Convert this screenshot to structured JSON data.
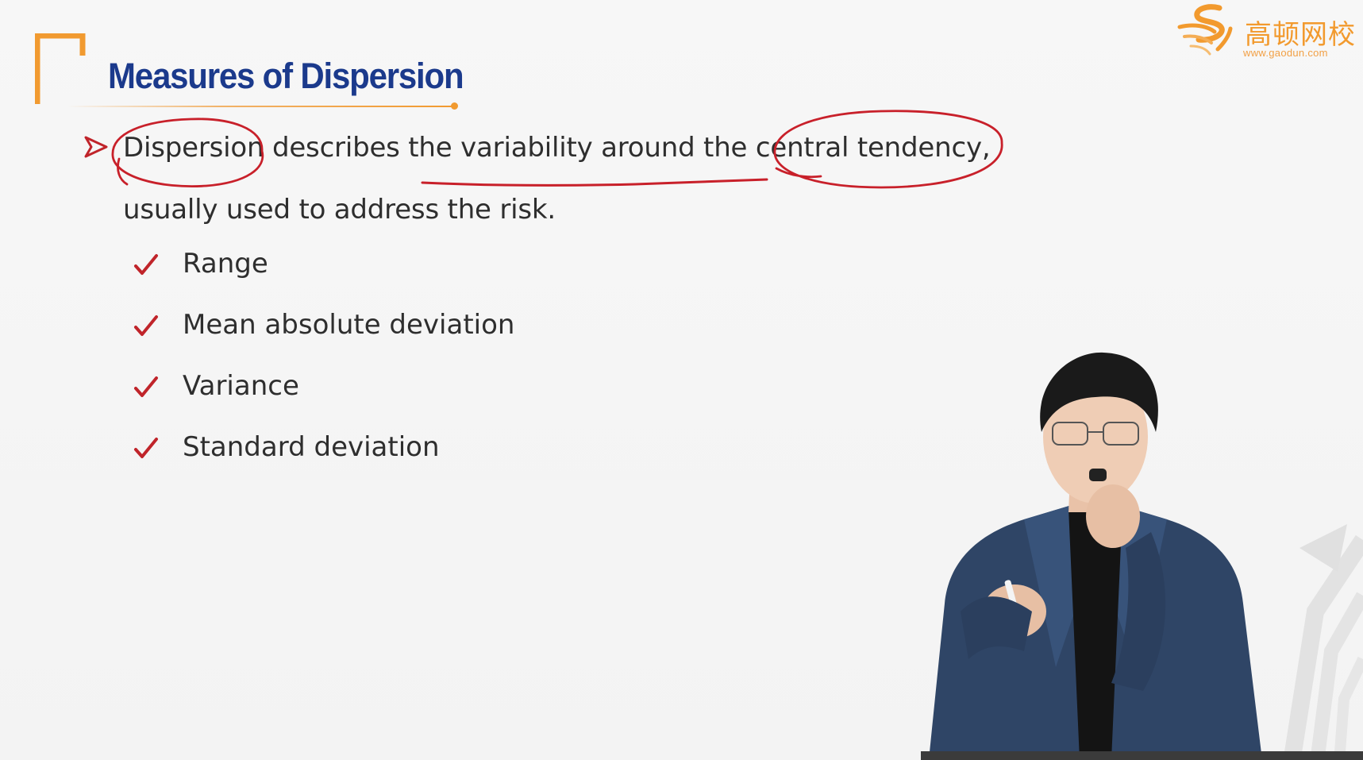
{
  "slide": {
    "title": "Measures of Dispersion",
    "intro": {
      "term": "Dispersion",
      "middle": " describes the variability around the ",
      "term2": "central tendency",
      "end": ",",
      "line2": "usually used to address the risk."
    },
    "items": [
      {
        "label": "Range"
      },
      {
        "label": "Mean absolute deviation"
      },
      {
        "label": "Variance"
      },
      {
        "label": "Standard deviation"
      }
    ]
  },
  "logo": {
    "cn_text": "高顿网校",
    "url": "www.gaodun.com"
  },
  "colors": {
    "title": "#1b3a8c",
    "accent_orange": "#f19a30",
    "check_red": "#c0242a",
    "annotation_red": "#c8202a",
    "text": "#2e2e2e"
  },
  "icons": {
    "bullet": "arrowhead-bullet-icon",
    "item_marker": "checkmark-icon"
  }
}
